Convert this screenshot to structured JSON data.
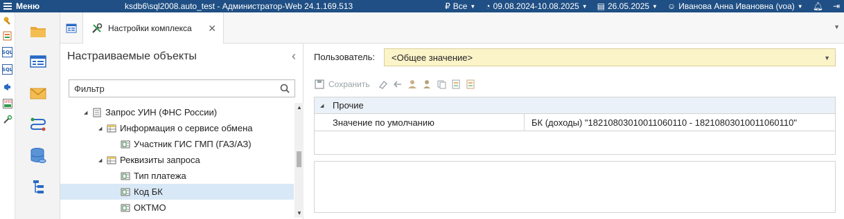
{
  "titlebar": {
    "menu_label": "Меню",
    "title": "ksdb6\\sql2008.auto_test - Администратор-Web 24.1.169.513",
    "currency_filter": "Все",
    "date_range": "09.08.2024-10.08.2025",
    "current_date": "26.05.2025",
    "user": "Иванова Анна Ивановна (voa)"
  },
  "tabs": [
    {
      "label": "Настройки комплекса",
      "icon": "tools-icon",
      "active": true
    }
  ],
  "left_panel": {
    "title": "Настраиваемые объекты",
    "filter_placeholder": "Фильтр",
    "tree": [
      {
        "label": "Запрос УИН (ФНС России)",
        "level": 0,
        "expanded": true,
        "icon": "document-icon"
      },
      {
        "label": "Информация о сервисе обмена",
        "level": 1,
        "expanded": true,
        "icon": "table-icon"
      },
      {
        "label": "Участник ГИС ГМП (ГАЗ/АЗ)",
        "level": 2,
        "icon": "field-icon"
      },
      {
        "label": "Реквизиты запроса",
        "level": 1,
        "expanded": true,
        "icon": "table-icon"
      },
      {
        "label": "Тип платежа",
        "level": 2,
        "icon": "field-icon"
      },
      {
        "label": "Код БК",
        "level": 2,
        "icon": "field-icon",
        "selected": true
      },
      {
        "label": "ОКТМО",
        "level": 2,
        "icon": "field-icon"
      }
    ]
  },
  "right_panel": {
    "user_label": "Пользователь:",
    "user_value": "<Общее значение>",
    "toolbar": {
      "save_label": "Сохранить"
    },
    "grid": {
      "group": "Прочие",
      "rows": [
        {
          "name": "Значение по умолчанию",
          "value": "БК (доходы) \"18210803010011060110 - 18210803010011060110\""
        }
      ]
    }
  },
  "colors": {
    "titlebar": "#1f4f84",
    "selection": "#d9e8f6",
    "user_select_bg": "#fcf4c9",
    "grid_group_bg": "#eaf1f8"
  }
}
